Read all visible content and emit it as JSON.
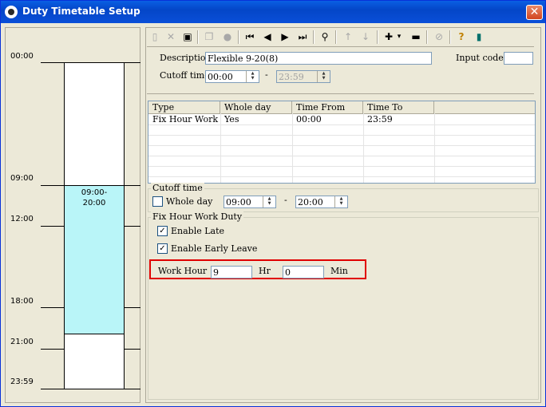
{
  "window": {
    "title": "Duty Timetable Setup",
    "close_label": "✕"
  },
  "timeline": {
    "ticks": [
      {
        "label": "00:00"
      },
      {
        "label": "09:00"
      },
      {
        "label": "12:00"
      },
      {
        "label": "18:00"
      },
      {
        "label": "21:00"
      },
      {
        "label": "23:59"
      }
    ],
    "shift_label_line1": "09:00-",
    "shift_label_line2": "20:00",
    "shift_color": "#b9f5f8"
  },
  "toolbar": {
    "icons": [
      "new-icon",
      "delete-icon",
      "save-icon",
      "copy-icon",
      "record-icon",
      "first-icon",
      "previous-icon",
      "next-icon",
      "last-icon",
      "find-icon",
      "up-icon",
      "down-icon",
      "add-icon",
      "remove-icon",
      "clear-icon",
      "help-icon",
      "exit-icon"
    ],
    "dropdown_glyph": "▾"
  },
  "form": {
    "description_label": "Description",
    "description_value": "Flexible 9-20(8)",
    "input_code_label": "Input code :",
    "input_code_value": "",
    "cutoff_label": "Cutoff time",
    "cutoff_from": "00:00",
    "cutoff_dash": "-",
    "cutoff_to": "23:59"
  },
  "table": {
    "headers": [
      "Type",
      "Whole day",
      "Time From",
      "Time To"
    ],
    "rows": [
      {
        "type": "Fix Hour Work ...",
        "whole_day": "Yes",
        "time_from": "00:00",
        "time_to": "23:59"
      }
    ]
  },
  "cutoff_group": {
    "title": "Cutoff time",
    "whole_day_label": "Whole day",
    "whole_day_checked": false,
    "from": "09:00",
    "dash": "-",
    "to": "20:00"
  },
  "fix_hour_group": {
    "title": "Fix Hour Work Duty",
    "enable_late_label": "Enable Late",
    "enable_late_checked": true,
    "enable_early_label": "Enable Early Leave",
    "enable_early_checked": true,
    "work_hour_label": "Work Hour",
    "hours_value": "9",
    "hr_label": "Hr",
    "minutes_value": "0",
    "min_label": "Min",
    "highlight_color": "#e00000"
  }
}
